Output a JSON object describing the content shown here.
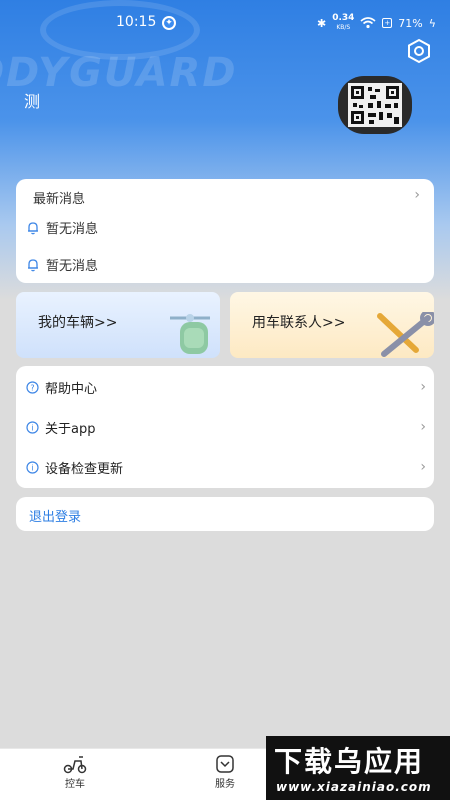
{
  "status_bar": {
    "time": "10:15",
    "net_speed": "0.34",
    "net_unit": "KB/S",
    "battery": "71%"
  },
  "brand_watermark": "ODYGUARD",
  "user": {
    "name": "测"
  },
  "news": {
    "title": "最新消息",
    "items": [
      "暂无消息",
      "暂无消息"
    ]
  },
  "tiles": {
    "vehicle_label": "我的车辆>>",
    "contacts_label": "用车联系人>>"
  },
  "menu": {
    "items": [
      {
        "label": "帮助中心",
        "icon": "question-icon"
      },
      {
        "label": "关于app",
        "icon": "info-icon"
      },
      {
        "label": "设备检查更新",
        "icon": "info-icon"
      }
    ]
  },
  "logout_label": "退出登录",
  "bottom_nav": {
    "tabs": [
      {
        "label": "控车",
        "icon": "scooter-icon"
      },
      {
        "label": "服务",
        "icon": "service-icon"
      }
    ]
  },
  "site_watermark": {
    "title": "下载乌应用",
    "url": "www.xiazainiao.com"
  },
  "colors": {
    "accent": "#2f7fe3",
    "background": "#dcdcdc"
  }
}
